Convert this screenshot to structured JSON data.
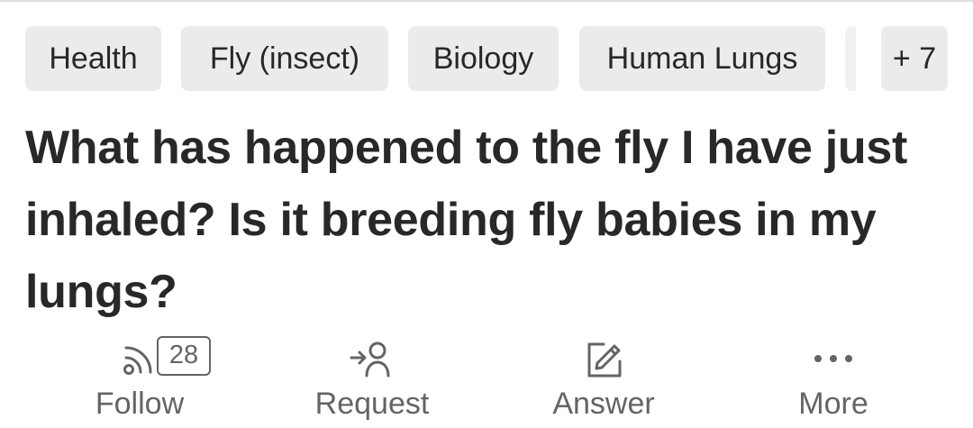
{
  "tags": {
    "items": [
      "Health",
      "Fly (insect)",
      "Biology",
      "Human Lungs"
    ],
    "more_label": "+ 7"
  },
  "question": {
    "title": "What has happened to the fly I have just inhaled? Is it breeding fly babies in my lungs?"
  },
  "actions": {
    "follow": {
      "label": "Follow",
      "count": "28",
      "icon": "follow-rss-icon"
    },
    "request": {
      "label": "Request",
      "icon": "request-person-icon"
    },
    "answer": {
      "label": "Answer",
      "icon": "pencil-edit-icon"
    },
    "more": {
      "label": "More",
      "icon": "ellipsis-icon"
    }
  },
  "colors": {
    "tag_background": "#ebebeb",
    "text_primary": "#282829",
    "text_secondary": "#636466"
  }
}
